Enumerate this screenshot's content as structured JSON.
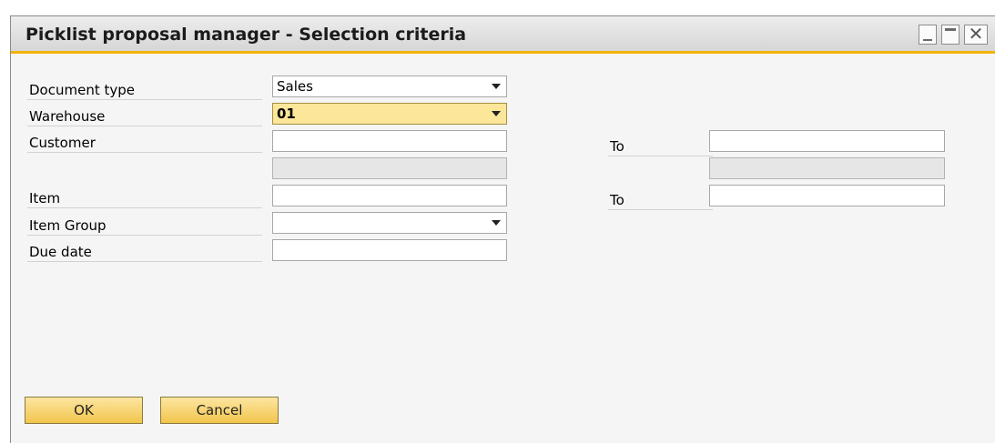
{
  "window": {
    "title": "Picklist proposal manager - Selection criteria",
    "close_glyph": "✕"
  },
  "form": {
    "document_type": {
      "label": "Document type",
      "value": "Sales"
    },
    "warehouse": {
      "label": "Warehouse",
      "value": "01"
    },
    "customer": {
      "label": "Customer",
      "value": "",
      "to_label": "To",
      "to_value": ""
    },
    "item": {
      "label": "Item",
      "value": "",
      "to_label": "To",
      "to_value": ""
    },
    "item_group": {
      "label": "Item Group",
      "value": ""
    },
    "due_date": {
      "label": "Due date",
      "value": ""
    }
  },
  "buttons": {
    "ok": "OK",
    "cancel": "Cancel"
  },
  "colors": {
    "accent": "#f3b300",
    "selected_field": "#fbe699",
    "button": "#f2c54b"
  }
}
